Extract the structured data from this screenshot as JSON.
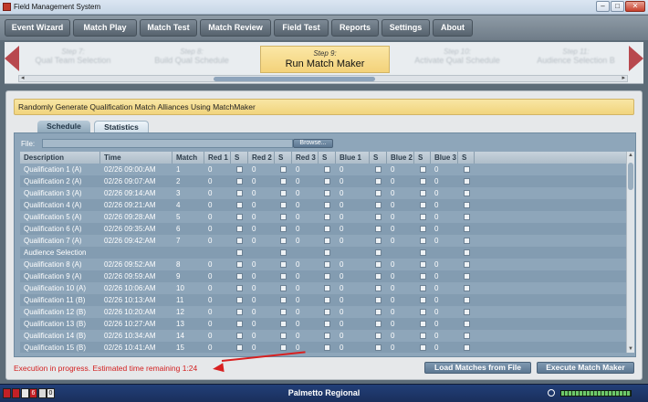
{
  "window": {
    "title": "Field Management System",
    "minimize": "–",
    "maximize": "□",
    "close": "✕"
  },
  "menu": [
    "Event Wizard",
    "Match Play",
    "Match Test",
    "Match Review",
    "Field Test",
    "Reports",
    "Settings",
    "About"
  ],
  "wizard": {
    "prev2": {
      "step": "Step 7:",
      "label": "Qual Team Selection"
    },
    "prev1": {
      "step": "Step 8:",
      "label": "Build Qual Schedule"
    },
    "current": {
      "step": "Step 9:",
      "label": "Run Match Maker"
    },
    "next1": {
      "step": "Step 10:",
      "label": "Activate Qual Schedule"
    },
    "next2": {
      "step": "Step 11:",
      "label": "Audience Selection B"
    }
  },
  "banner": "Randomly Generate Qualification Match Alliances Using MatchMaker",
  "tabs": {
    "schedule": "Schedule",
    "statistics": "Statistics"
  },
  "file": {
    "label": "File:",
    "value": "",
    "browse": "Browse..."
  },
  "grid": {
    "columns": [
      "Description",
      "Time",
      "Match",
      "Red 1",
      "S",
      "Red 2",
      "S",
      "Red 3",
      "S",
      "Blue 1",
      "S",
      "Blue 2",
      "S",
      "Blue 3",
      "S"
    ],
    "rows": [
      {
        "desc": "Qualification 1 (A)",
        "time": "02/26 09:00:AM",
        "match": "1",
        "teams": [
          "0",
          "0",
          "0",
          "0",
          "0",
          "0"
        ]
      },
      {
        "desc": "Qualification 2 (A)",
        "time": "02/26 09:07:AM",
        "match": "2",
        "teams": [
          "0",
          "0",
          "0",
          "0",
          "0",
          "0"
        ]
      },
      {
        "desc": "Qualification 3 (A)",
        "time": "02/26 09:14:AM",
        "match": "3",
        "teams": [
          "0",
          "0",
          "0",
          "0",
          "0",
          "0"
        ]
      },
      {
        "desc": "Qualification 4 (A)",
        "time": "02/26 09:21:AM",
        "match": "4",
        "teams": [
          "0",
          "0",
          "0",
          "0",
          "0",
          "0"
        ]
      },
      {
        "desc": "Qualification 5 (A)",
        "time": "02/26 09:28:AM",
        "match": "5",
        "teams": [
          "0",
          "0",
          "0",
          "0",
          "0",
          "0"
        ]
      },
      {
        "desc": "Qualification 6 (A)",
        "time": "02/26 09:35:AM",
        "match": "6",
        "teams": [
          "0",
          "0",
          "0",
          "0",
          "0",
          "0"
        ]
      },
      {
        "desc": "Qualification 7 (A)",
        "time": "02/26 09:42:AM",
        "match": "7",
        "teams": [
          "0",
          "0",
          "0",
          "0",
          "0",
          "0"
        ]
      },
      {
        "desc": "Audience Selection",
        "time": "",
        "match": "",
        "teams": [
          "",
          "",
          "",
          "",
          "",
          ""
        ]
      },
      {
        "desc": "Qualification 8 (A)",
        "time": "02/26 09:52:AM",
        "match": "8",
        "teams": [
          "0",
          "0",
          "0",
          "0",
          "0",
          "0"
        ]
      },
      {
        "desc": "Qualification 9 (A)",
        "time": "02/26 09:59:AM",
        "match": "9",
        "teams": [
          "0",
          "0",
          "0",
          "0",
          "0",
          "0"
        ]
      },
      {
        "desc": "Qualification 10 (A)",
        "time": "02/26 10:06:AM",
        "match": "10",
        "teams": [
          "0",
          "0",
          "0",
          "0",
          "0",
          "0"
        ]
      },
      {
        "desc": "Qualification 11 (B)",
        "time": "02/26 10:13:AM",
        "match": "11",
        "teams": [
          "0",
          "0",
          "0",
          "0",
          "0",
          "0"
        ]
      },
      {
        "desc": "Qualification 12 (B)",
        "time": "02/26 10:20:AM",
        "match": "12",
        "teams": [
          "0",
          "0",
          "0",
          "0",
          "0",
          "0"
        ]
      },
      {
        "desc": "Qualification 13 (B)",
        "time": "02/26 10:27:AM",
        "match": "13",
        "teams": [
          "0",
          "0",
          "0",
          "0",
          "0",
          "0"
        ]
      },
      {
        "desc": "Qualification 14 (B)",
        "time": "02/26 10:34:AM",
        "match": "14",
        "teams": [
          "0",
          "0",
          "0",
          "0",
          "0",
          "0"
        ]
      },
      {
        "desc": "Qualification 15 (B)",
        "time": "02/26 10:41:AM",
        "match": "15",
        "teams": [
          "0",
          "0",
          "0",
          "0",
          "0",
          "0"
        ]
      }
    ]
  },
  "status": "Execution in progress. Estimated time remaining 1:24",
  "buttons": {
    "load": "Load Matches from File",
    "execute": "Execute Match Maker"
  },
  "statusbar": {
    "event": "Palmetto Regional",
    "counter": "6",
    "counter2": "0"
  },
  "colors": {
    "status_red": "#d32020",
    "banner_gold": "#f1d47d",
    "statusbar_blue": "#1f3a73"
  }
}
